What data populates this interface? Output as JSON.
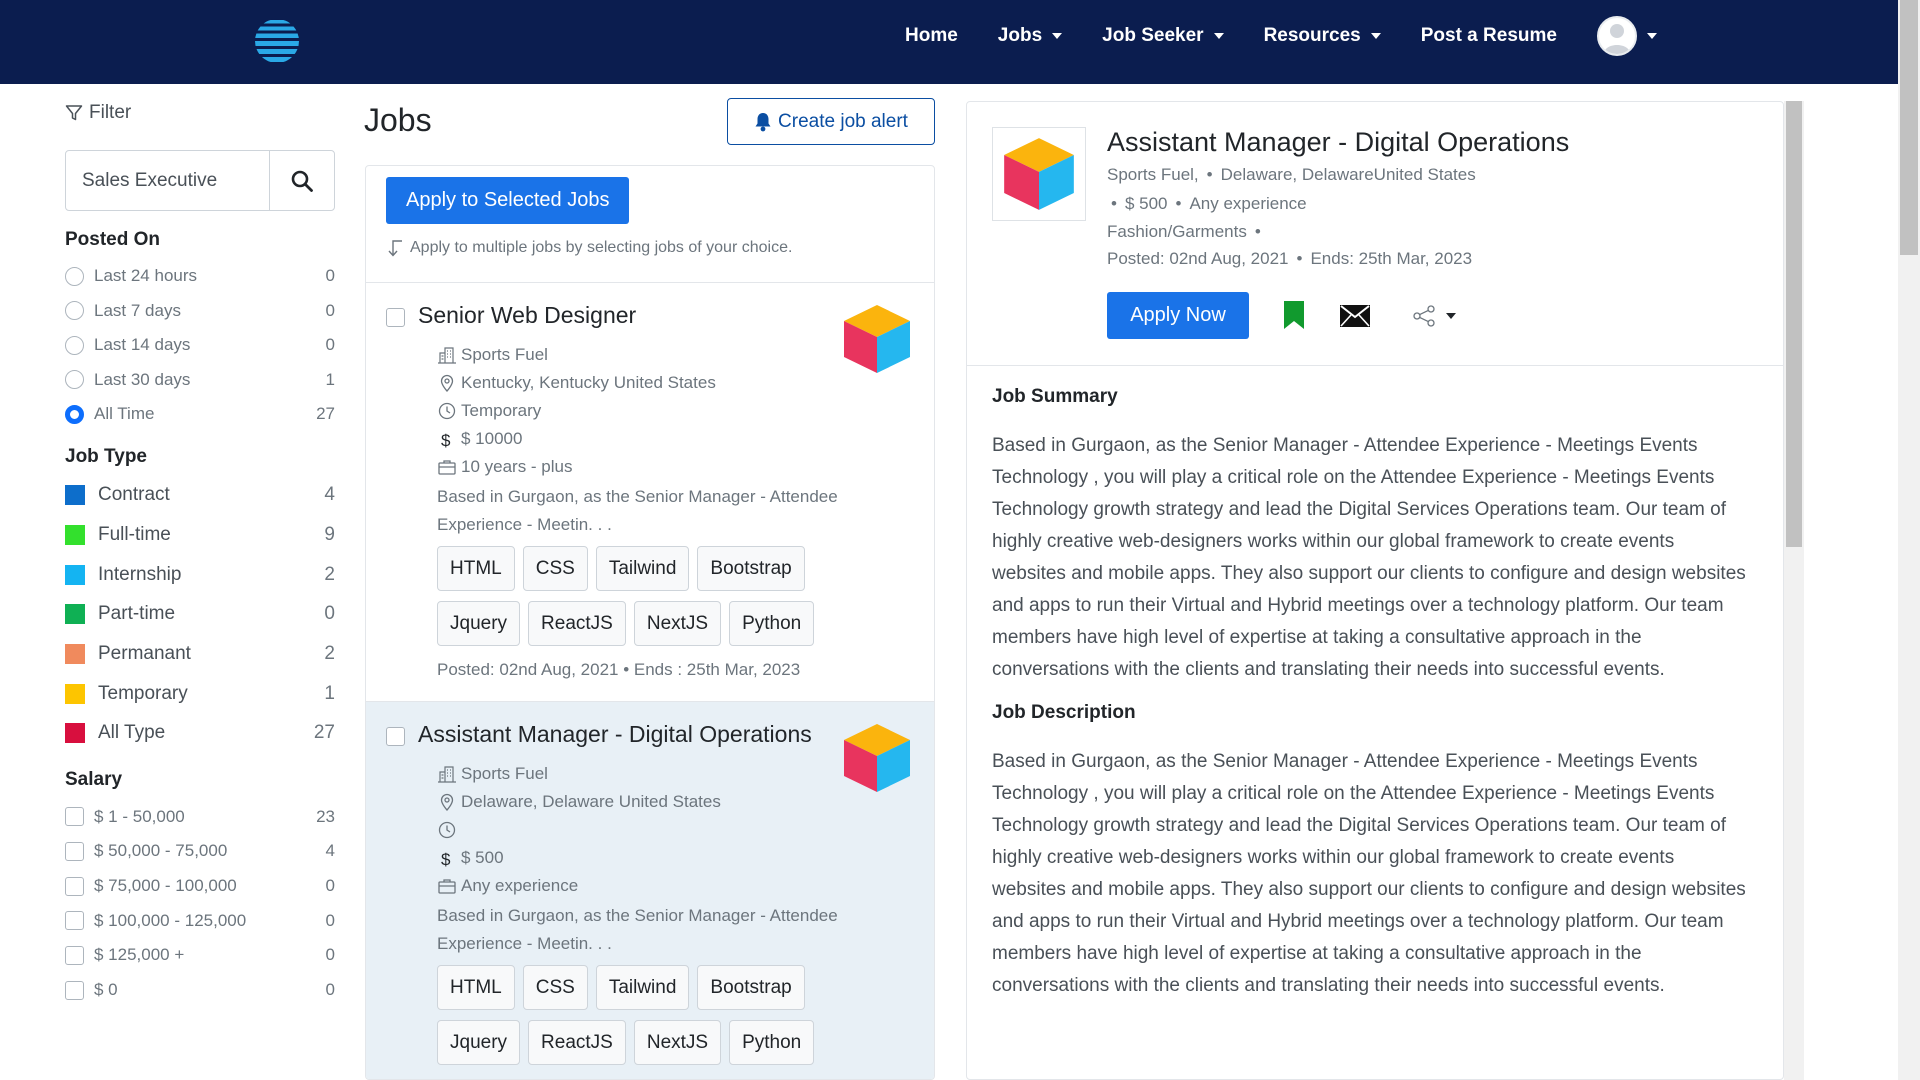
{
  "nav": {
    "items": [
      {
        "label": "Home",
        "dropdown": false
      },
      {
        "label": "Jobs",
        "dropdown": true
      },
      {
        "label": "Job Seeker",
        "dropdown": true
      },
      {
        "label": "Resources",
        "dropdown": true
      },
      {
        "label": "Post a Resume",
        "dropdown": false
      }
    ]
  },
  "filter": {
    "title": "Filter",
    "search_value": "Sales Executive",
    "posted_on": {
      "title": "Posted On",
      "options": [
        {
          "label": "Last 24 hours",
          "count": "0",
          "selected": false
        },
        {
          "label": "Last 7 days",
          "count": "0",
          "selected": false
        },
        {
          "label": "Last 14 days",
          "count": "0",
          "selected": false
        },
        {
          "label": "Last 30 days",
          "count": "1",
          "selected": false
        },
        {
          "label": "All Time",
          "count": "27",
          "selected": true
        }
      ]
    },
    "job_type": {
      "title": "Job Type",
      "options": [
        {
          "label": "Contract",
          "count": "4",
          "color": "#0d6ecb"
        },
        {
          "label": "Full-time",
          "count": "9",
          "color": "#33e02d"
        },
        {
          "label": "Internship",
          "count": "2",
          "color": "#14b4f2"
        },
        {
          "label": "Part-time",
          "count": "0",
          "color": "#0fb054"
        },
        {
          "label": "Permanant",
          "count": "2",
          "color": "#f08a5d"
        },
        {
          "label": "Temporary",
          "count": "1",
          "color": "#fdc500"
        },
        {
          "label": "All Type",
          "count": "27",
          "color": "#d80f3e"
        }
      ]
    },
    "salary": {
      "title": "Salary",
      "options": [
        {
          "label": "$ 1 - 50,000",
          "count": "23"
        },
        {
          "label": "$ 50,000 - 75,000",
          "count": "4"
        },
        {
          "label": "$ 75,000 - 100,000",
          "count": "0"
        },
        {
          "label": "$ 100,000 - 125,000",
          "count": "0"
        },
        {
          "label": "$ 125,000 +",
          "count": "0"
        },
        {
          "label": "$ 0",
          "count": "0"
        }
      ]
    }
  },
  "jobs": {
    "heading": "Jobs",
    "create_alert_label": "Create job alert",
    "apply_selected_label": "Apply to Selected Jobs",
    "apply_hint": "Apply to multiple jobs by selecting jobs of your choice.",
    "cards": [
      {
        "title": "Senior Web Designer",
        "company": "Sports Fuel",
        "location": "Kentucky, Kentucky United States",
        "type": "Temporary",
        "salary": "$ 10000",
        "experience": "10 years - plus",
        "desc": "Based in Gurgaon, as the Senior Manager - Attendee Experience - Meetin. . .",
        "tags": [
          "HTML",
          "CSS",
          "Tailwind",
          "Bootstrap",
          "Jquery",
          "ReactJS",
          "NextJS",
          "Python"
        ],
        "dates": "Posted: 02nd Aug, 2021  •  Ends : 25th Mar, 2023"
      },
      {
        "title": "Assistant Manager - Digital Operations",
        "company": "Sports Fuel",
        "location": "Delaware, Delaware United States",
        "type": "",
        "salary": "$ 500",
        "experience": "Any experience",
        "desc": "Based in Gurgaon, as the Senior Manager - Attendee Experience - Meetin. . .",
        "tags": [
          "HTML",
          "CSS",
          "Tailwind",
          "Bootstrap",
          "Jquery",
          "ReactJS",
          "NextJS",
          "Python"
        ]
      }
    ]
  },
  "detail": {
    "title": "Assistant Manager - Digital Operations",
    "company": "Sports Fuel,",
    "location": "Delaware, DelawareUnited States",
    "salary": "$ 500",
    "experience": "Any experience",
    "category": "Fashion/Garments",
    "posted": "Posted: 02nd Aug, 2021",
    "ends": "Ends: 25th Mar, 2023",
    "apply_label": "Apply Now",
    "summary_title": "Job Summary",
    "summary_text": "Based in Gurgaon, as the Senior Manager - Attendee Experience - Meetings Events Technology , you will play a critical role on the Attendee Experience - Meetings Events Technology growth strategy and lead the Digital Services Operations team. Our team of highly creative web-designers works within our global framework to create events websites and mobile apps. They also support our clients to configure and design websites and apps to run their Virtual and Hybrid meetings over a technology platform. Our team members have high level of expertise at taking a consultative approach in the conversations with the clients and translating their needs into successful events.",
    "description_title": "Job Description",
    "description_text": "Based in Gurgaon, as the Senior Manager - Attendee Experience - Meetings Events Technology , you will play a critical role on the Attendee Experience - Meetings Events Technology growth strategy and lead the Digital Services Operations team. Our team of highly creative web-designers works within our global framework to create events websites and mobile apps. They also support our clients to configure and design websites and apps to run their Virtual and Hybrid meetings over a technology platform. Our team members have high level of expertise at taking a consultative approach in the conversations with the clients and translating their needs into successful events."
  }
}
